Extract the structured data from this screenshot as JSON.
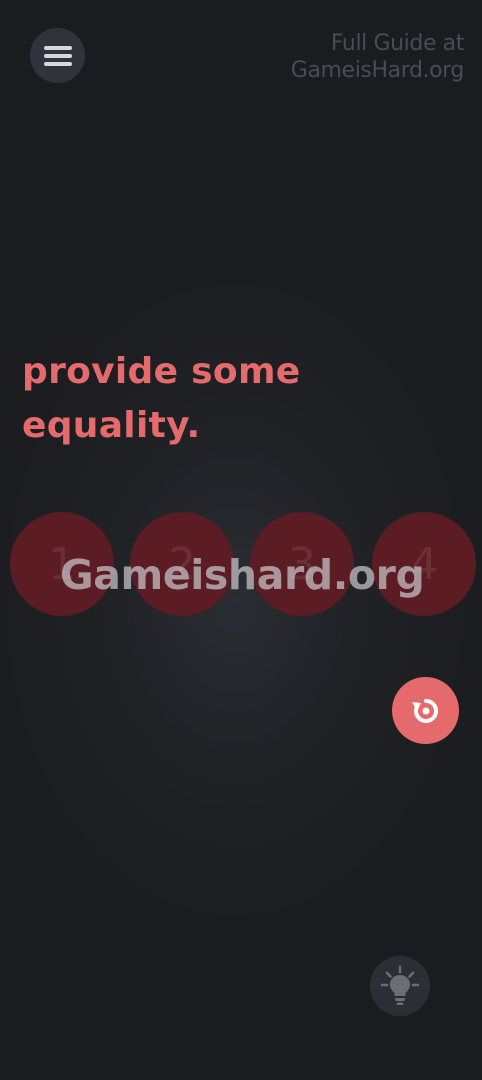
{
  "header": {
    "menu_icon": "hamburger-menu-icon",
    "watermark_line1": "Full Guide at",
    "watermark_line2": "GameisHard.org"
  },
  "puzzle": {
    "prompt_line1": "provide some",
    "prompt_line2": "equality.",
    "options": [
      {
        "label": "1"
      },
      {
        "label": "2"
      },
      {
        "label": "3"
      },
      {
        "label": "4"
      }
    ],
    "watermark_overlay": "Gameishard.org"
  },
  "controls": {
    "reset_icon": "reset-icon",
    "hint_icon": "lightbulb-icon"
  },
  "colors": {
    "accent": "#e46a6c",
    "background": "#1e2024",
    "option_circle": "#5b1c24",
    "button_bg": "#30333b"
  }
}
